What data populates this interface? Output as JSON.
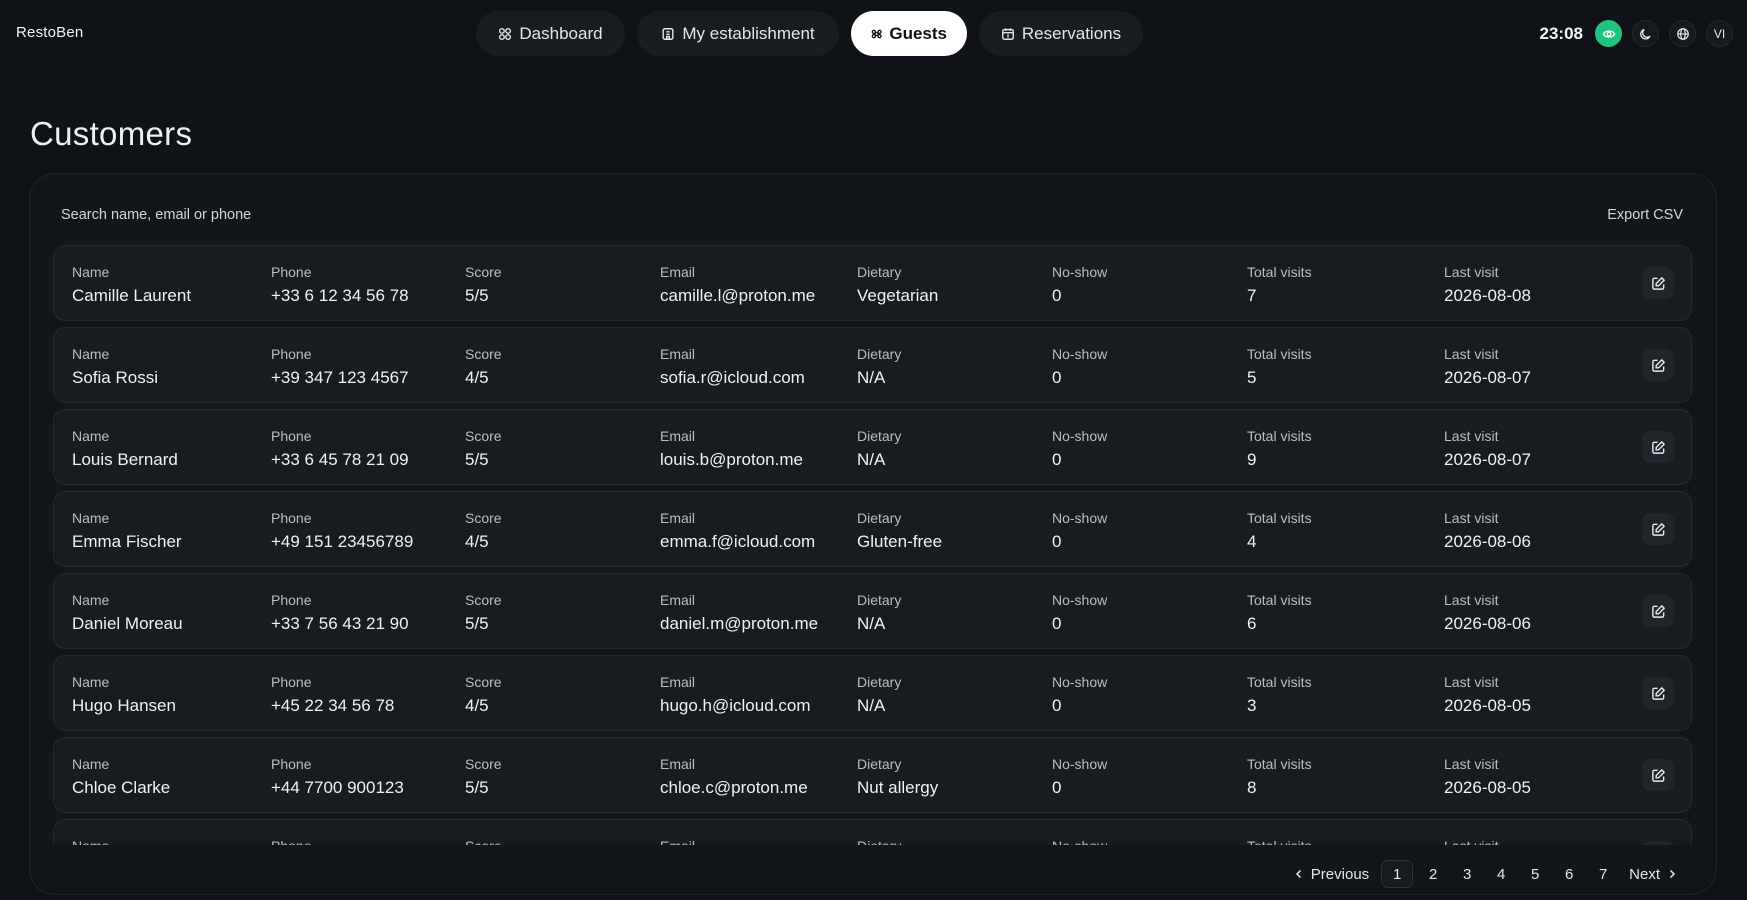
{
  "app": {
    "brand": "RestoBen",
    "clock": "23:08",
    "user_initials": "VI"
  },
  "nav": [
    {
      "label": "Dashboard",
      "icon": "dashboard-icon"
    },
    {
      "label": "My establishment",
      "icon": "building-icon"
    },
    {
      "label": "Guests",
      "icon": "guests-icon",
      "active": true
    },
    {
      "label": "Reservations",
      "icon": "calendar-icon"
    }
  ],
  "page": {
    "title": "Customers"
  },
  "toolbar": {
    "search_placeholder": "Search name, email or phone",
    "export_label": "Export CSV"
  },
  "columns": {
    "name": "Name",
    "phone": "Phone",
    "score": "Score",
    "email": "Email",
    "dietary": "Dietary",
    "noshow": "No-show",
    "visits": "Total visits",
    "last": "Last visit"
  },
  "rows": [
    {
      "name": "Camille Laurent",
      "phone": "+33 6 12 34 56 78",
      "score": "5/5",
      "email": "camille.l@proton.me",
      "dietary": "Vegetarian",
      "noshow": "0",
      "visits": "7",
      "last": "2026-08-08"
    },
    {
      "name": "Sofia Rossi",
      "phone": "+39 347 123 4567",
      "score": "4/5",
      "email": "sofia.r@icloud.com",
      "dietary": "N/A",
      "noshow": "0",
      "visits": "5",
      "last": "2026-08-07"
    },
    {
      "name": "Louis Bernard",
      "phone": "+33 6 45 78 21 09",
      "score": "5/5",
      "email": "louis.b@proton.me",
      "dietary": "N/A",
      "noshow": "0",
      "visits": "9",
      "last": "2026-08-07"
    },
    {
      "name": "Emma Fischer",
      "phone": "+49 151 23456789",
      "score": "4/5",
      "email": "emma.f@icloud.com",
      "dietary": "Gluten-free",
      "noshow": "0",
      "visits": "4",
      "last": "2026-08-06"
    },
    {
      "name": "Daniel Moreau",
      "phone": "+33 7 56 43 21 90",
      "score": "5/5",
      "email": "daniel.m@proton.me",
      "dietary": "N/A",
      "noshow": "0",
      "visits": "6",
      "last": "2026-08-06"
    },
    {
      "name": "Hugo Hansen",
      "phone": "+45 22 34 56 78",
      "score": "4/5",
      "email": "hugo.h@icloud.com",
      "dietary": "N/A",
      "noshow": "0",
      "visits": "3",
      "last": "2026-08-05"
    },
    {
      "name": "Chloe Clarke",
      "phone": "+44 7700 900123",
      "score": "5/5",
      "email": "chloe.c@proton.me",
      "dietary": "Nut allergy",
      "noshow": "0",
      "visits": "8",
      "last": "2026-08-05"
    },
    {
      "name": "",
      "phone": "",
      "score": "",
      "email": "",
      "dietary": "",
      "noshow": "",
      "visits": "",
      "last": ""
    }
  ],
  "pagination": {
    "previous": "Previous",
    "next": "Next",
    "pages": [
      "1",
      "2",
      "3",
      "4",
      "5",
      "6",
      "7"
    ],
    "current": "1"
  },
  "colors": {
    "accent_green": "#1fc47f",
    "background": "#0f1317"
  }
}
